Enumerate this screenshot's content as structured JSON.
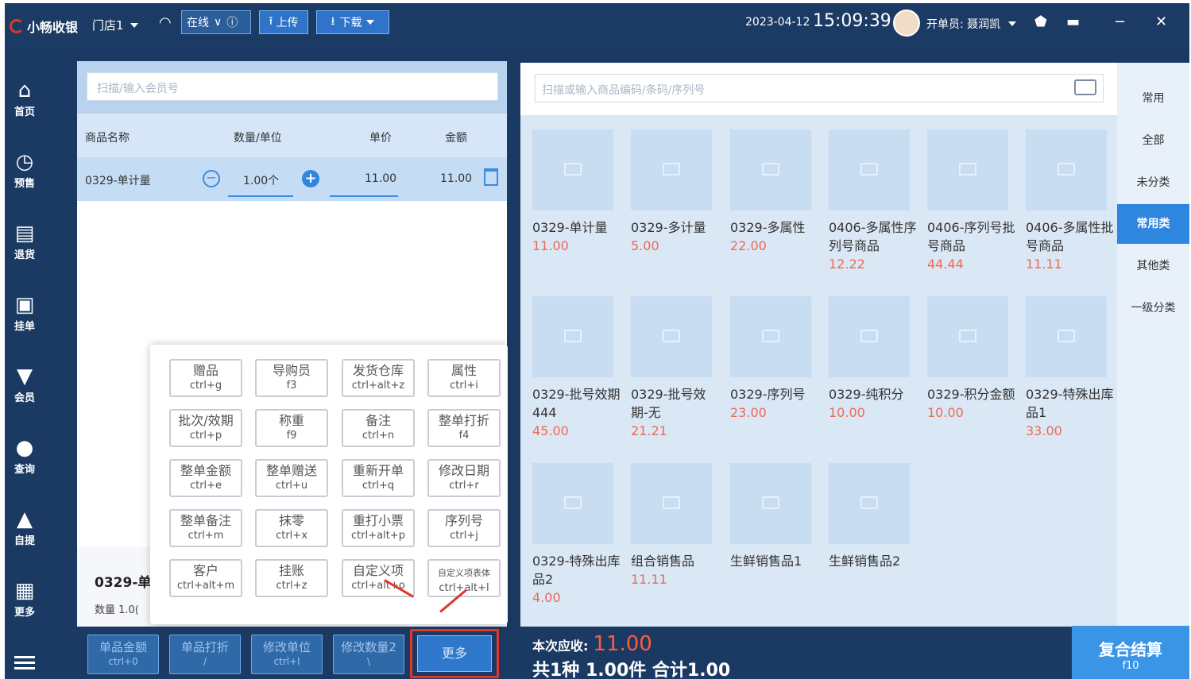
{
  "titlebar": {
    "app_name": "小畅收银",
    "store": "门店1",
    "status": "在线",
    "upload": "上传",
    "download": "下载",
    "date": "2023-04-12",
    "time": "15:09:39",
    "operator": "开单员: 聂润凯"
  },
  "nav": {
    "items": [
      {
        "label": "首页",
        "icon": "home-icon"
      },
      {
        "label": "预售",
        "icon": "clock-icon"
      },
      {
        "label": "退货",
        "icon": "return-icon"
      },
      {
        "label": "挂单",
        "icon": "hold-icon"
      },
      {
        "label": "会员",
        "icon": "member-icon"
      },
      {
        "label": "查询",
        "icon": "search-icon"
      },
      {
        "label": "自提",
        "icon": "bag-icon"
      },
      {
        "label": "更多",
        "icon": "grid-icon"
      }
    ]
  },
  "cart": {
    "member_placeholder": "扫描/输入会员号",
    "headers": {
      "name": "商品名称",
      "qty": "数量/单位",
      "unit_price": "单价",
      "amount": "金额"
    },
    "row": {
      "name": "0329-单计量",
      "qty": "1.00个",
      "unit_price": "11.00",
      "amount": "11.00"
    },
    "summary_name": "0329-单i",
    "summary_qty": "数量  1.0("
  },
  "popup": {
    "buttons": [
      {
        "label": "赠品",
        "key": "ctrl+g"
      },
      {
        "label": "导购员",
        "key": "f3"
      },
      {
        "label": "发货仓库",
        "key": "ctrl+alt+z"
      },
      {
        "label": "属性",
        "key": "ctrl+i"
      },
      {
        "label": "批次/效期",
        "key": "ctrl+p"
      },
      {
        "label": "称重",
        "key": "f9"
      },
      {
        "label": "备注",
        "key": "ctrl+n"
      },
      {
        "label": "整单打折",
        "key": "f4"
      },
      {
        "label": "整单金额",
        "key": "ctrl+e"
      },
      {
        "label": "整单赠送",
        "key": "ctrl+u"
      },
      {
        "label": "重新开单",
        "key": "ctrl+q"
      },
      {
        "label": "修改日期",
        "key": "ctrl+r"
      },
      {
        "label": "整单备注",
        "key": "ctrl+m"
      },
      {
        "label": "抹零",
        "key": "ctrl+x"
      },
      {
        "label": "重打小票",
        "key": "ctrl+alt+p"
      },
      {
        "label": "序列号",
        "key": "ctrl+j"
      },
      {
        "label": "客户",
        "key": "ctrl+alt+m"
      },
      {
        "label": "挂账",
        "key": "ctrl+z"
      },
      {
        "label": "自定义项",
        "key": "ctrl+alt+o"
      },
      {
        "label": "自定义项表体",
        "key": "ctrl+alt+l"
      }
    ]
  },
  "bottom_left": {
    "buttons": [
      {
        "label": "单品金额",
        "key": "ctrl+0"
      },
      {
        "label": "单品打折",
        "key": "/"
      },
      {
        "label": "修改单位",
        "key": "ctrl+l"
      },
      {
        "label": "修改数量2",
        "key": "\\"
      }
    ],
    "more": "更多"
  },
  "products": {
    "search_placeholder": "扫描或输入商品编码/条码/序列号",
    "items": [
      {
        "name": "0329-单计量",
        "price": "11.00"
      },
      {
        "name": "0329-多计量",
        "price": "5.00"
      },
      {
        "name": "0329-多属性",
        "price": "22.00"
      },
      {
        "name": "0406-多属性序列号商品",
        "price": "12.22"
      },
      {
        "name": "0406-序列号批号商品",
        "price": "44.44"
      },
      {
        "name": "0406-多属性批号商品",
        "price": "11.11"
      },
      {
        "name": "0329-批号效期444",
        "price": "45.00"
      },
      {
        "name": "0329-批号效期-无",
        "price": "21.21"
      },
      {
        "name": "0329-序列号",
        "price": "23.00"
      },
      {
        "name": "0329-纯积分",
        "price": "10.00"
      },
      {
        "name": "0329-积分金额",
        "price": "10.00"
      },
      {
        "name": "0329-特殊出库品1",
        "price": "33.00"
      },
      {
        "name": "0329-特殊出库品2",
        "price": "4.00"
      },
      {
        "name": "组合销售品",
        "price": "11.11"
      },
      {
        "name": "生鲜销售品1",
        "price": ""
      },
      {
        "name": "生鲜销售品2",
        "price": ""
      }
    ]
  },
  "categories": {
    "items": [
      "常用",
      "全部",
      "未分类",
      "常用类",
      "其他类",
      "一级分类"
    ],
    "active": "常用类"
  },
  "payment": {
    "due_label": "本次应收:",
    "due_amount": "11.00",
    "summary": "共1种 1.00件 合计1.00",
    "checkout_label": "复合结算",
    "checkout_key": "f10"
  },
  "colors": {
    "titlebar": "#1c3b64",
    "accent": "#2e86de",
    "price_red": "#ef6a55",
    "highlight_red": "#e2352b"
  }
}
